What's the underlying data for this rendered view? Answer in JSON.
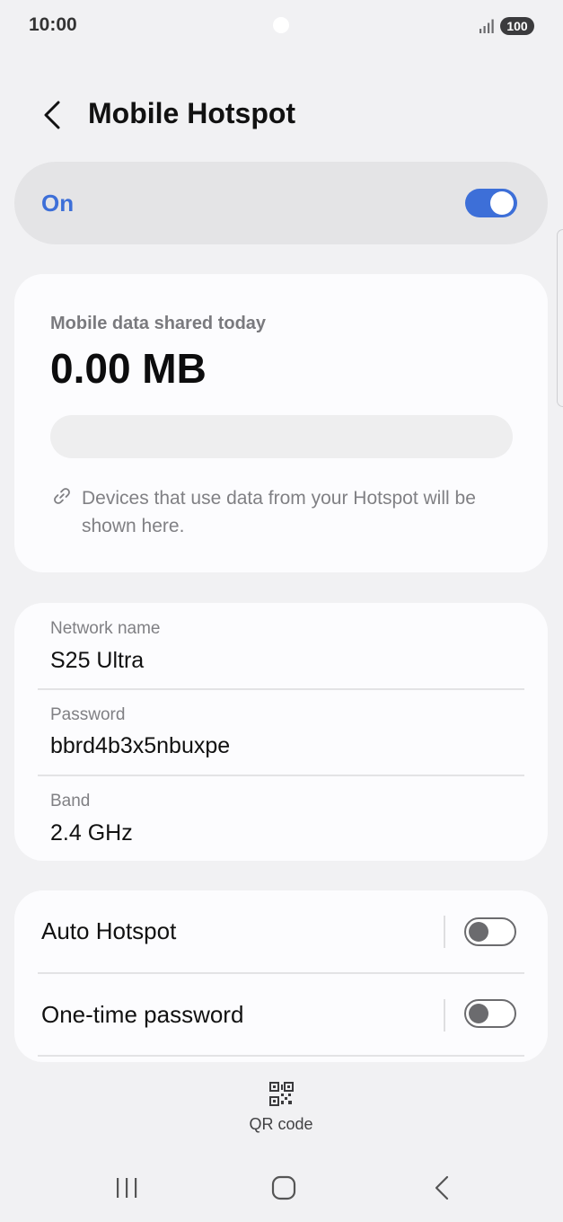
{
  "status_bar": {
    "time": "10:00",
    "battery": "100",
    "signal_icon": "signal-bars-icon"
  },
  "header": {
    "back_icon": "chevron-left-icon",
    "title": "Mobile Hotspot"
  },
  "master_switch": {
    "label": "On",
    "enabled": true,
    "accent_color": "#3d6fd8"
  },
  "data_usage": {
    "label": "Mobile data shared today",
    "value": "0.00 MB",
    "usage_fraction": 0,
    "note_icon": "link-icon",
    "note": "Devices that use data from your Hotspot will be shown here."
  },
  "network": {
    "rows": [
      {
        "label": "Network name",
        "value": "S25 Ultra"
      },
      {
        "label": "Password",
        "value": "bbrd4b3x5nbuxpe"
      },
      {
        "label": "Band",
        "value": "2.4 GHz"
      }
    ]
  },
  "options": [
    {
      "label": "Auto Hotspot",
      "enabled": false
    },
    {
      "label": "One-time password",
      "enabled": false
    }
  ],
  "qr_code": {
    "icon": "qr-code-icon",
    "label": "QR code"
  },
  "nav_bar": {
    "recents_icon": "recents-icon",
    "home_icon": "home-icon",
    "back_icon": "back-icon"
  }
}
